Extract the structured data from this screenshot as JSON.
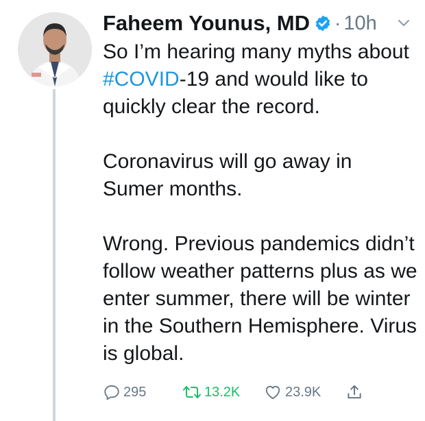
{
  "author": {
    "name": "Faheem Younus, MD",
    "time": "10h",
    "separator": "·"
  },
  "tweet": {
    "line1_before": "So I’m hearing many myths about ",
    "hashtag": "#COVID",
    "line1_after": "-19 and would like to quickly clear the record.",
    "para2": "Coronavirus will go away in Sumer months.",
    "para3": "Wrong. Previous pandemics didn’t follow weather patterns plus as we enter summer, there will be winter in the Southern Hemisphere. Virus is global."
  },
  "actions": {
    "replies": "295",
    "retweets": "13.2K",
    "likes": "23.9K"
  },
  "colors": {
    "link": "#1b95e0",
    "retweet": "#17bf63",
    "muted": "#657786",
    "verified": "#1da1f2"
  },
  "icons": [
    "verified-badge-icon",
    "chevron-down-icon",
    "reply-icon",
    "retweet-icon",
    "like-icon",
    "share-icon"
  ]
}
